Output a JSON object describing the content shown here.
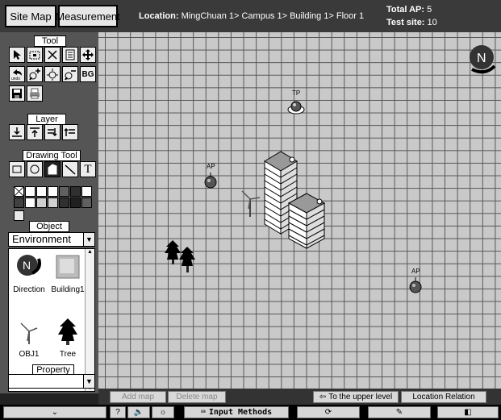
{
  "tabs": {
    "site_map": "Site Map",
    "measurement": "Measurement"
  },
  "location": {
    "label": "Location:",
    "path": "MingChuan 1> Campus 1> Building 1> Floor 1"
  },
  "stats": {
    "total_ap_label": "Total AP:",
    "total_ap_value": "5",
    "test_site_label": "Test site:",
    "test_site_value": "10"
  },
  "sections": {
    "tool": "Tool",
    "layer": "Layer",
    "drawing_tool": "Drawing Tool",
    "object": "Object",
    "property": "Property"
  },
  "object_category": "Environment",
  "objects": [
    {
      "label": "Direction",
      "icon": "direction-icon"
    },
    {
      "label": "Building1",
      "icon": "building-icon"
    },
    {
      "label": "OBJ1",
      "icon": "windmill-icon"
    },
    {
      "label": "Tree",
      "icon": "tree-icon"
    }
  ],
  "bg_tool_label": "BG",
  "undo_label": "undo",
  "palette": [
    "#ffffff",
    "#ffffff",
    "#ffffff",
    "#ffffff",
    "#606060",
    "#303030",
    "#ffffff",
    "#404040",
    "#ffffff",
    "#d0d0d0",
    "#d0d0d0",
    "#303030",
    "#202020"
  ],
  "map": {
    "compass_label": "N",
    "markers": [
      {
        "label": "TP"
      },
      {
        "label": "AP"
      },
      {
        "label": "AP"
      }
    ]
  },
  "bottom": {
    "add_map": "Add map",
    "delete_map": "Delete map",
    "upper_level": "To the upper level",
    "location_relation": "Location Relation"
  },
  "taskbar": {
    "help": "?",
    "input_methods": "Input Methods"
  }
}
